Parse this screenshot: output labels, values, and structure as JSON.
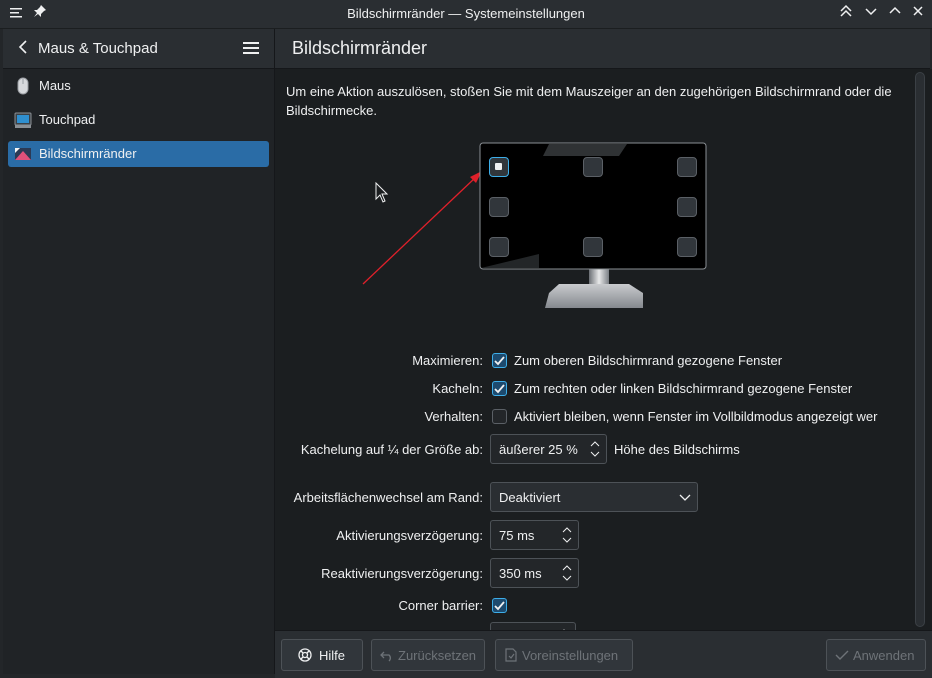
{
  "window": {
    "title": "Bildschirmränder — Systemeinstellungen"
  },
  "sidebar": {
    "title": "Maus & Touchpad",
    "items": [
      {
        "label": "Maus",
        "icon": "mouse-icon"
      },
      {
        "label": "Touchpad",
        "icon": "touchpad-icon"
      },
      {
        "label": "Bildschirmränder",
        "icon": "screen-edges-icon",
        "active": true
      }
    ]
  },
  "main": {
    "title": "Bildschirmränder",
    "description": "Um eine Aktion auszulösen, stoßen Sie mit dem Mauszeiger an den zugehörigen Bildschirmrand oder die Bildschirmecke."
  },
  "form": {
    "maximize": {
      "label": "Maximieren:",
      "text": "Zum oberen Bildschirmrand gezogene Fenster",
      "checked": true
    },
    "tile": {
      "label": "Kacheln:",
      "text": "Zum rechten oder linken Bildschirmrand gezogene Fenster",
      "checked": true
    },
    "behavior": {
      "label": "Verhalten:",
      "text": "Aktiviert bleiben, wenn Fenster im Vollbildmodus angezeigt wer",
      "checked": false
    },
    "quarter_tiling": {
      "label": "Kachelung auf ¼ der Größe ab:",
      "value": "äußerer 25 %",
      "suffix": "Höhe des Bildschirms"
    },
    "desktop_switch": {
      "label": "Arbeitsflächenwechsel am Rand:",
      "value": "Deaktiviert"
    },
    "activation_delay": {
      "label": "Aktivierungsverzögerung:",
      "value": "75 ms"
    },
    "reactivation_delay": {
      "label": "Reaktivierungsverzögerung:",
      "value": "350 ms"
    },
    "corner_barrier": {
      "label": "Corner barrier:",
      "checked": true
    }
  },
  "footer": {
    "help": "Hilfe",
    "reset": "Zurücksetzen",
    "defaults": "Voreinstellungen",
    "apply": "Anwenden"
  },
  "colors": {
    "accent": "#3daee9",
    "selection": "#2a6ca6",
    "arrow": "#e0202a"
  }
}
